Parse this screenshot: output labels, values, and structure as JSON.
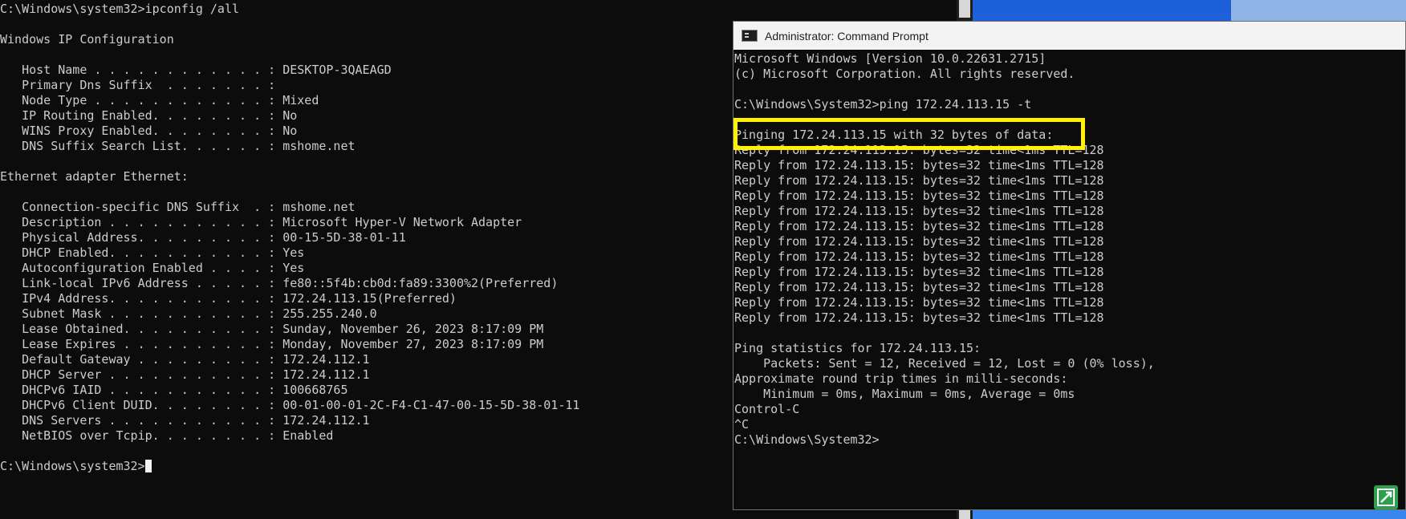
{
  "left_console": {
    "lines": [
      "C:\\Windows\\system32>ipconfig /all",
      "",
      "Windows IP Configuration",
      "",
      "   Host Name . . . . . . . . . . . . : DESKTOP-3QAEAGD",
      "   Primary Dns Suffix  . . . . . . . :",
      "   Node Type . . . . . . . . . . . . : Mixed",
      "   IP Routing Enabled. . . . . . . . : No",
      "   WINS Proxy Enabled. . . . . . . . : No",
      "   DNS Suffix Search List. . . . . . : mshome.net",
      "",
      "Ethernet adapter Ethernet:",
      "",
      "   Connection-specific DNS Suffix  . : mshome.net",
      "   Description . . . . . . . . . . . : Microsoft Hyper-V Network Adapter",
      "   Physical Address. . . . . . . . . : 00-15-5D-38-01-11",
      "   DHCP Enabled. . . . . . . . . . . : Yes",
      "   Autoconfiguration Enabled . . . . : Yes",
      "   Link-local IPv6 Address . . . . . : fe80::5f4b:cb0d:fa89:3300%2(Preferred)",
      "   IPv4 Address. . . . . . . . . . . : 172.24.113.15(Preferred)",
      "   Subnet Mask . . . . . . . . . . . : 255.255.240.0",
      "   Lease Obtained. . . . . . . . . . : Sunday, November 26, 2023 8:17:09 PM",
      "   Lease Expires . . . . . . . . . . : Monday, November 27, 2023 8:17:09 PM",
      "   Default Gateway . . . . . . . . . : 172.24.112.1",
      "   DHCP Server . . . . . . . . . . . : 172.24.112.1",
      "   DHCPv6 IAID . . . . . . . . . . . : 100668765",
      "   DHCPv6 Client DUID. . . . . . . . : 00-01-00-01-2C-F4-C1-47-00-15-5D-38-01-11",
      "   DNS Servers . . . . . . . . . . . : 172.24.112.1",
      "   NetBIOS over Tcpip. . . . . . . . : Enabled",
      ""
    ],
    "prompt": "C:\\Windows\\system32>"
  },
  "admin_window": {
    "title": "Administrator: Command Prompt",
    "icon": "command-prompt-icon",
    "lines": [
      "Microsoft Windows [Version 10.0.22631.2715]",
      "(c) Microsoft Corporation. All rights reserved.",
      "",
      "C:\\Windows\\System32>ping 172.24.113.15 -t",
      "",
      "Pinging 172.24.113.15 with 32 bytes of data:",
      "Reply from 172.24.113.15: bytes=32 time<1ms TTL=128",
      "Reply from 172.24.113.15: bytes=32 time<1ms TTL=128",
      "Reply from 172.24.113.15: bytes=32 time<1ms TTL=128",
      "Reply from 172.24.113.15: bytes=32 time<1ms TTL=128",
      "Reply from 172.24.113.15: bytes=32 time<1ms TTL=128",
      "Reply from 172.24.113.15: bytes=32 time<1ms TTL=128",
      "Reply from 172.24.113.15: bytes=32 time<1ms TTL=128",
      "Reply from 172.24.113.15: bytes=32 time<1ms TTL=128",
      "Reply from 172.24.113.15: bytes=32 time<1ms TTL=128",
      "Reply from 172.24.113.15: bytes=32 time<1ms TTL=128",
      "Reply from 172.24.113.15: bytes=32 time<1ms TTL=128",
      "Reply from 172.24.113.15: bytes=32 time<1ms TTL=128",
      "",
      "Ping statistics for 172.24.113.15:",
      "    Packets: Sent = 12, Received = 12, Lost = 0 (0% loss),",
      "Approximate round trip times in milli-seconds:",
      "    Minimum = 0ms, Maximum = 0ms, Average = 0ms",
      "Control-C",
      "^C",
      "C:\\Windows\\System32>"
    ]
  },
  "colors": {
    "console_bg": "#0c0c0c",
    "console_text": "#cccccc",
    "highlight": "#fff200",
    "titlebar_bg": "#f3f3f3",
    "desktop_blue": "#1e6ae6"
  },
  "corner_icon": "snipping-tool-icon"
}
